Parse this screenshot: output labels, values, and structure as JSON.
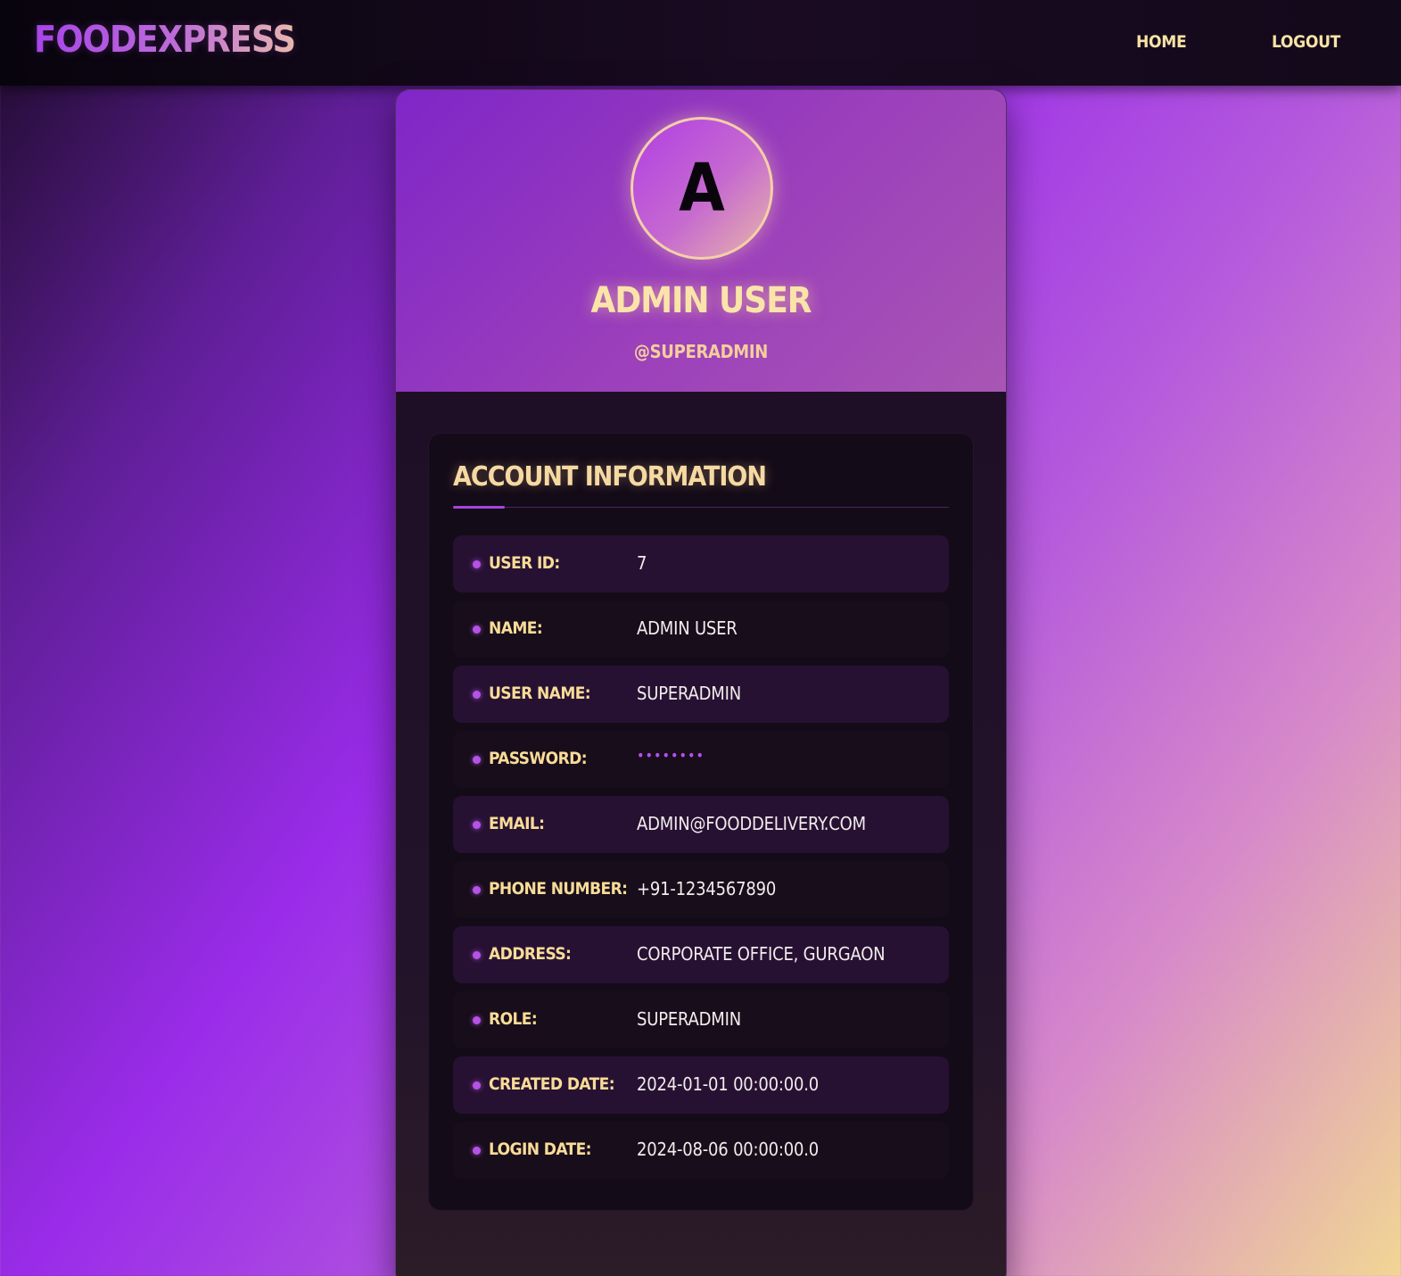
{
  "nav": {
    "brand": "FOODEXPRESS",
    "home": "HOME",
    "logout": "LOGOUT"
  },
  "profile": {
    "avatar_initial": "A",
    "name": "ADMIN USER",
    "handle": "@SUPERADMIN"
  },
  "account": {
    "title": "ACCOUNT INFORMATION",
    "rows": [
      {
        "label": "USER ID:",
        "value": "7"
      },
      {
        "label": "NAME:",
        "value": "ADMIN USER"
      },
      {
        "label": "USER NAME:",
        "value": "SUPERADMIN"
      },
      {
        "label": "PASSWORD:",
        "value": "••••••••"
      },
      {
        "label": "EMAIL:",
        "value": "ADMIN@FOODDELIVERY.COM"
      },
      {
        "label": "PHONE NUMBER:",
        "value": "+91-1234567890"
      },
      {
        "label": "ADDRESS:",
        "value": "CORPORATE OFFICE, GURGAON"
      },
      {
        "label": "ROLE:",
        "value": "SUPERADMIN"
      },
      {
        "label": "CREATED DATE:",
        "value": "2024-01-01 00:00:00.0"
      },
      {
        "label": "LOGIN DATE:",
        "value": "2024-08-06 00:00:00.0"
      }
    ]
  },
  "colors": {
    "accent": "#a544e0",
    "label": "#f8dc97",
    "nav_bg": "#12091a"
  }
}
